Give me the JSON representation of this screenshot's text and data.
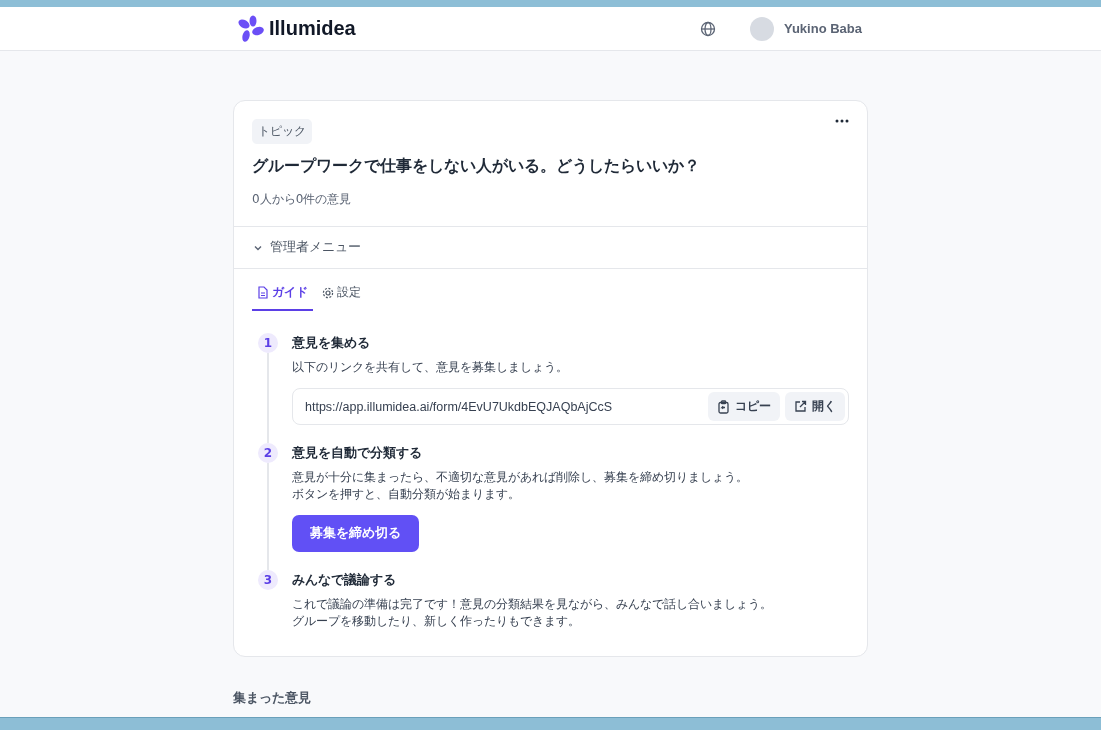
{
  "header": {
    "logo": "Illumidea",
    "user_name": "Yukino Baba"
  },
  "topic": {
    "badge": "トピック",
    "title": "グループワークで仕事をしない人がいる。どうしたらいいか？",
    "summary": "0人から0件の意見"
  },
  "admin_menu": {
    "label": "管理者メニュー",
    "expanded": true,
    "tabs": [
      {
        "label": "ガイド",
        "kind": "guide",
        "selected": true
      },
      {
        "label": "設定",
        "kind": "settings",
        "selected": false
      }
    ],
    "steps": [
      {
        "number": "1",
        "title": "意見を集める",
        "lines": [
          "以下のリンクを共有して、意見を募集しましょう。"
        ],
        "link": {
          "url": "https://app.illumidea.ai/form/4EvU7UkdbEQJAQbAjCcS",
          "copy": "コピー",
          "open": "開く"
        }
      },
      {
        "number": "2",
        "title": "意見を自動で分類する",
        "lines": [
          "意見が十分に集まったら、不適切な意見があれば削除し、募集を締め切りましょう。",
          "ボタンを押すと、自動分類が始まります。"
        ],
        "button": "募集を締め切る"
      },
      {
        "number": "3",
        "title": "みんなで議論する",
        "lines": [
          "これで議論の準備は完了です！意見の分類結果を見ながら、みんなで話し合いましょう。",
          "グループを移動したり、新しく作ったりもできます。"
        ]
      }
    ]
  },
  "opinions": {
    "heading": "集まった意見"
  }
}
